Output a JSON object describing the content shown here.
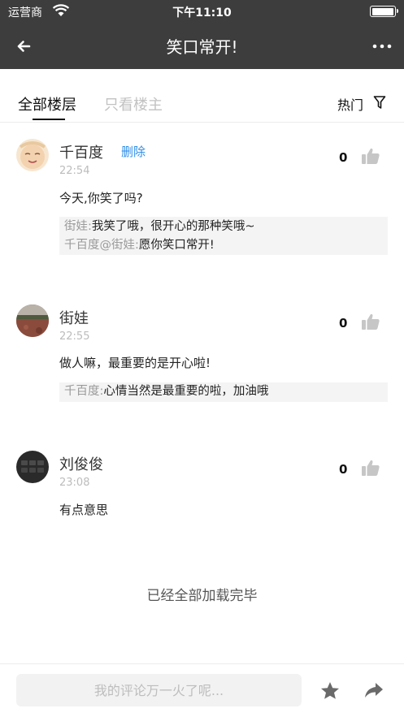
{
  "status_bar": {
    "carrier": "运营商",
    "time": "下午11:10"
  },
  "nav": {
    "title": "笑口常开!"
  },
  "tabs": {
    "all": "全部楼层",
    "owner_only": "只看楼主",
    "sort": "热门"
  },
  "comments": [
    {
      "author": "千百度",
      "delete_label": "删除",
      "time": "22:54",
      "likes": "0",
      "text": "今天,你笑了吗?",
      "replies": [
        {
          "name": "街娃:",
          "text": "我笑了哦，很开心的那种笑哦~"
        },
        {
          "name": "千百度@街娃:",
          "text": "愿你笑口常开!"
        }
      ]
    },
    {
      "author": "街娃",
      "time": "22:55",
      "likes": "0",
      "text": "做人嘛，最重要的是开心啦!",
      "replies": [
        {
          "name": "千百度:",
          "text": "心情当然是最重要的啦，加油哦"
        }
      ]
    },
    {
      "author": "刘俊俊",
      "time": "23:08",
      "likes": "0",
      "text": "有点意思",
      "replies": []
    }
  ],
  "end_note": "已经全部加载完毕",
  "bottom_bar": {
    "placeholder": "我的评论万一火了呢..."
  }
}
